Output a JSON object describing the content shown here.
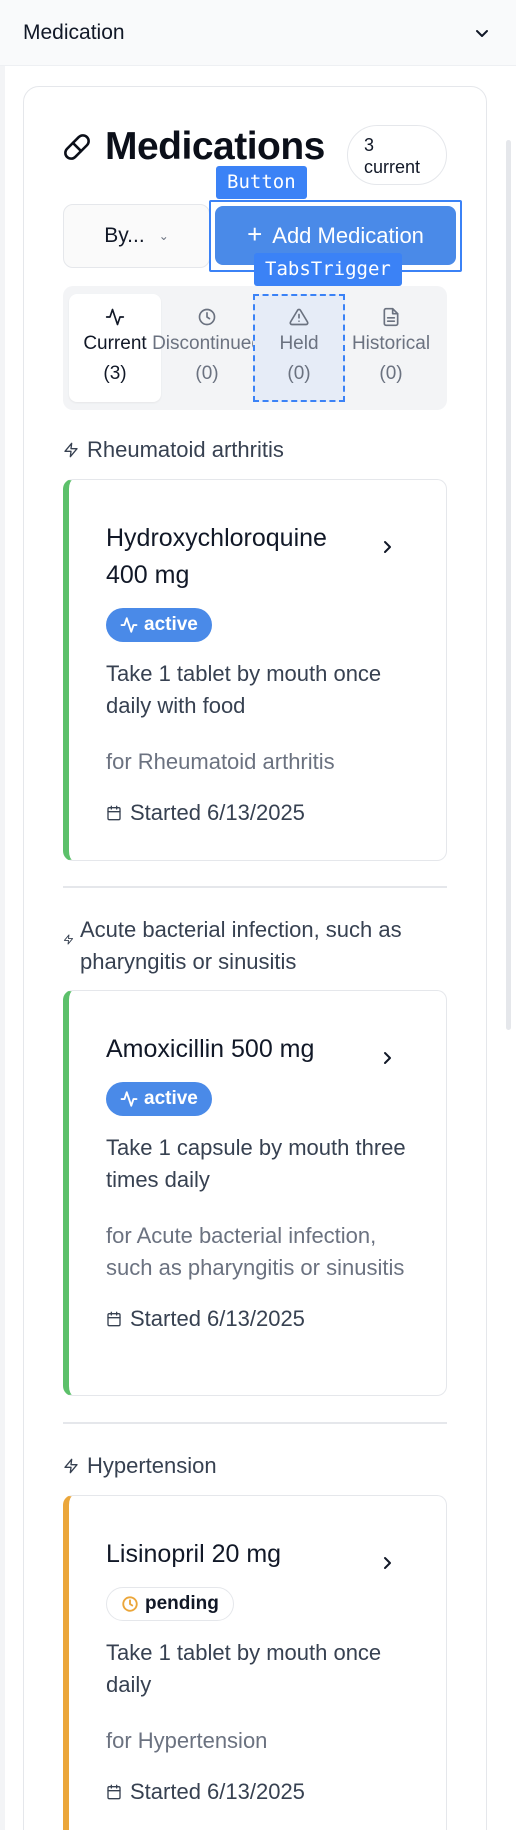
{
  "section": {
    "title": "Medication"
  },
  "card": {
    "title": "Medications",
    "count_line1": "3",
    "count_line2": "current",
    "sort_label": "By...",
    "add_label": "Add Medication"
  },
  "devtags": {
    "button": "Button",
    "tabs_trigger": "TabsTrigger"
  },
  "tabs": [
    {
      "label": "Current",
      "count": "(3)"
    },
    {
      "label": "Discontinued",
      "count": "(0)"
    },
    {
      "label": "Held",
      "count": "(0)"
    },
    {
      "label": "Historical",
      "count": "(0)"
    }
  ],
  "groups": [
    {
      "label": "Rheumatoid arthritis",
      "medication": {
        "name": "Hydroxychloroquine 400 mg",
        "status": "active",
        "instructions": "Take 1 tablet by mouth once daily with food",
        "indication": "for Rheumatoid arthritis",
        "started": "Started 6/13/2025"
      }
    },
    {
      "label": "Acute bacterial infection, such as pharyngitis or sinusitis",
      "medication": {
        "name": "Amoxicillin 500 mg",
        "status": "active",
        "instructions": "Take 1 capsule by mouth three times daily",
        "indication": "for Acute bacterial infection, such as pharyngitis or sinusitis",
        "started": "Started 6/13/2025"
      }
    },
    {
      "label": "Hypertension",
      "medication": {
        "name": "Lisinopril 20 mg",
        "status": "pending",
        "instructions": "Take 1 tablet by mouth once daily",
        "indication": "for Hypertension",
        "started": "Started 6/13/2025"
      }
    }
  ],
  "colors": {
    "accent": "#4a8ae8",
    "active_border": "#5cc06a",
    "pending_border": "#eba63a",
    "devtag": "#3b82f6"
  }
}
